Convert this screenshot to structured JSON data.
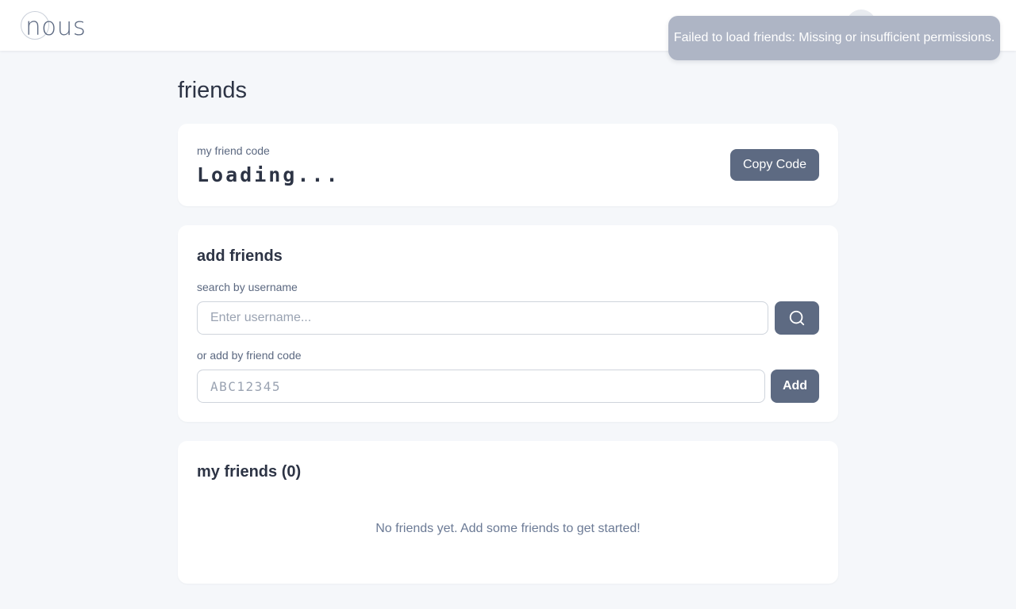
{
  "header": {
    "logo_text": "nous"
  },
  "toast": {
    "message": "Failed to load friends: Missing or insufficient permissions."
  },
  "page": {
    "title": "friends"
  },
  "friend_code_card": {
    "label": "my friend code",
    "value": "Loading...",
    "copy_button_label": "Copy Code"
  },
  "add_friends_card": {
    "heading": "add friends",
    "username_label": "search by username",
    "username_placeholder": "Enter username...",
    "search_icon": "search-icon",
    "code_label": "or add by friend code",
    "code_placeholder": "ABC12345",
    "add_button_label": "Add"
  },
  "friends_list_card": {
    "heading": "my friends (0)",
    "empty_message": "No friends yet. Add some friends to get started!"
  }
}
